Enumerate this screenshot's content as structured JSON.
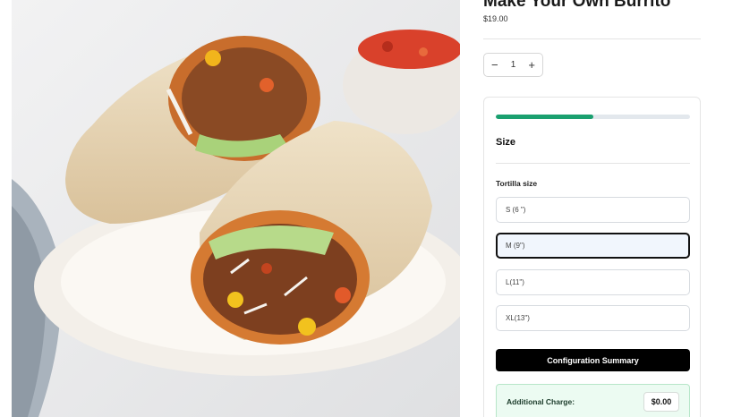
{
  "product": {
    "title": "Make Your Own Burrito",
    "price": "$19.00",
    "image_alt": "burrito-photo"
  },
  "quantity": {
    "minus": "−",
    "value": "1",
    "plus": "+"
  },
  "configurator": {
    "progress_fraction": 0.5,
    "accent_color": "#1aa06f",
    "section_title": "Size",
    "group_label": "Tortilla size",
    "options": [
      {
        "label": "S (6 \")",
        "selected": false
      },
      {
        "label": "M (9\")",
        "selected": true
      },
      {
        "label": "L(11\")",
        "selected": false
      },
      {
        "label": "XL(13\")",
        "selected": false
      }
    ],
    "summary_button": "Configuration Summary",
    "charge_label": "Additional Charge:",
    "charge_value": "$0.00"
  }
}
